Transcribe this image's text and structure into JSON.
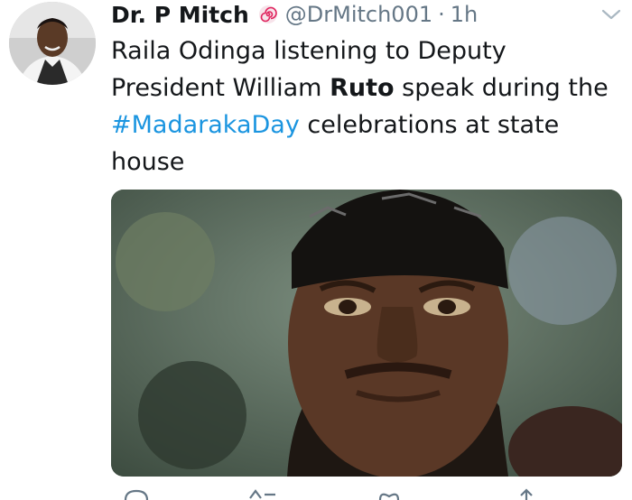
{
  "tweet": {
    "author_name": "Dr. P Mitch",
    "handle": "@DrMitch001",
    "separator": "·",
    "time": "1h",
    "text_part1": "Raila Odinga listening to Deputy President William ",
    "text_bold": "Ruto",
    "text_part2": " speak during the ",
    "hashtag": "#MadarakaDay",
    "text_part3": " celebrations at state house"
  },
  "colors": {
    "link": "#1b95e0",
    "secondary": "#657786",
    "badge": "#e0245e"
  },
  "icons": {
    "menu": "chevron-down-icon",
    "badge": "swirl-emoji-icon",
    "reply": "reply-icon",
    "retweet": "retweet-icon",
    "like": "heart-icon",
    "share": "share-icon"
  }
}
